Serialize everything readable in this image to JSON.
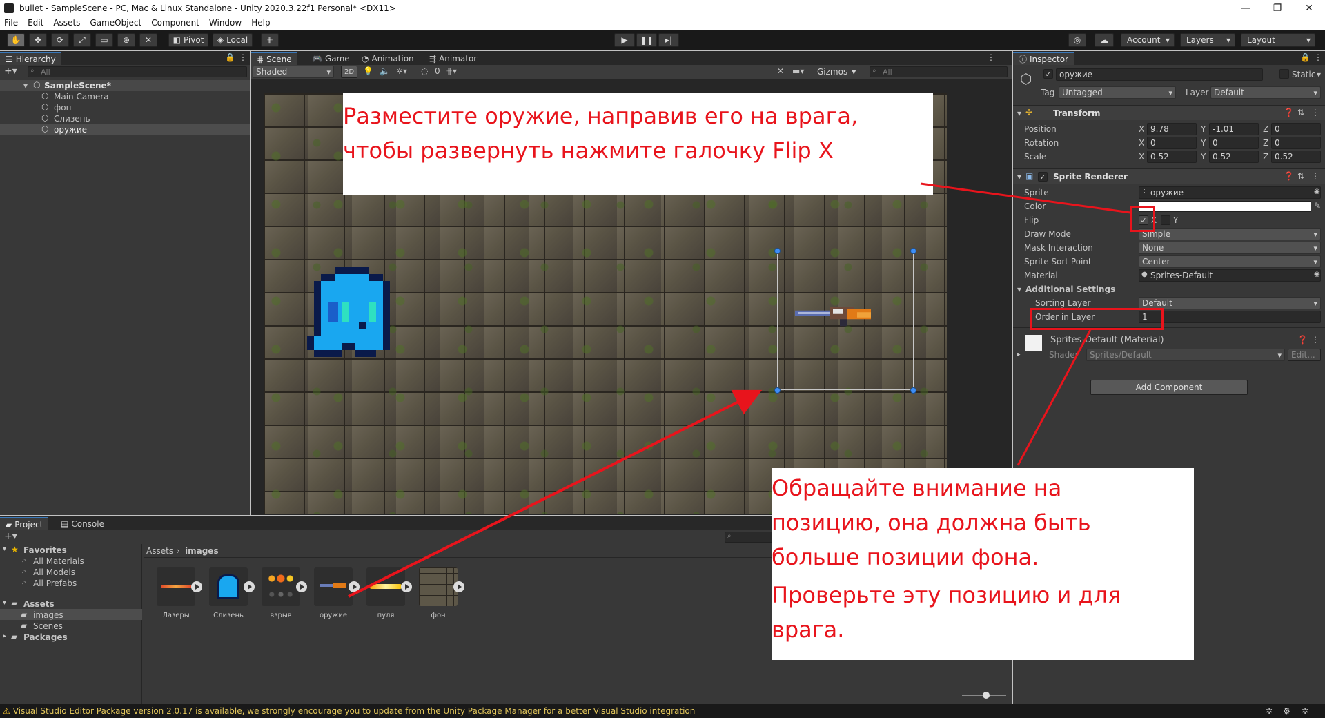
{
  "window": {
    "title": "bullet - SampleScene - PC, Mac & Linux Standalone - Unity 2020.3.22f1 Personal* <DX11>",
    "controls": [
      "—",
      "❐",
      "✕"
    ]
  },
  "menu": [
    "File",
    "Edit",
    "Assets",
    "GameObject",
    "Component",
    "Window",
    "Help"
  ],
  "toolbar": {
    "pivot": "Pivot",
    "local": "Local",
    "account": "Account",
    "layers": "Layers",
    "layout": "Layout"
  },
  "hierarchy": {
    "tab": "Hierarchy",
    "search_placeholder": "All",
    "scene": "SampleScene*",
    "items": [
      "Main Camera",
      "фон",
      "Слизень",
      "оружие"
    ]
  },
  "scene": {
    "tabs": [
      "Scene",
      "Game",
      "Animation",
      "Animator"
    ],
    "shading": "Shaded",
    "mode_2d": "2D",
    "hidden_count": "0",
    "gizmos": "Gizmos",
    "search_placeholder": "All"
  },
  "inspector": {
    "tab": "Inspector",
    "object_name": "оружие",
    "static": "Static",
    "tag_label": "Tag",
    "tag": "Untagged",
    "layer_label": "Layer",
    "layer": "Default",
    "transform": {
      "title": "Transform",
      "position_label": "Position",
      "rotation_label": "Rotation",
      "scale_label": "Scale",
      "axis_x": "X",
      "axis_y": "Y",
      "axis_z": "Z",
      "position": [
        "9.78",
        "-1.01",
        "0"
      ],
      "rotation": [
        "0",
        "0",
        "0"
      ],
      "scale": [
        "0.52",
        "0.52",
        "0.52"
      ]
    },
    "sprite_renderer": {
      "title": "Sprite Renderer",
      "sprite_label": "Sprite",
      "sprite": "оружие",
      "color_label": "Color",
      "flip_label": "Flip",
      "flip_x": "X",
      "flip_y": "Y",
      "draw_mode_label": "Draw Mode",
      "draw_mode": "Simple",
      "mask_label": "Mask Interaction",
      "mask": "None",
      "sort_point_label": "Sprite Sort Point",
      "sort_point": "Center",
      "material_label": "Material",
      "material": "Sprites-Default",
      "additional": "Additional Settings",
      "sorting_layer_label": "Sorting Layer",
      "sorting_layer": "Default",
      "order_label": "Order in Layer",
      "order": "1"
    },
    "material": {
      "title": "Sprites-Default (Material)",
      "shader_label": "Shader",
      "shader": "Sprites/Default",
      "edit": "Edit..."
    },
    "add_component": "Add Component"
  },
  "project": {
    "tabs": [
      "Project",
      "Console"
    ],
    "favorites": "Favorites",
    "favorite_items": [
      "All Materials",
      "All Models",
      "All Prefabs"
    ],
    "assets": "Assets",
    "asset_folders": [
      "images",
      "Scenes"
    ],
    "packages": "Packages",
    "breadcrumb_root": "Assets",
    "breadcrumb_current": "images",
    "files": [
      "Лазеры",
      "Слизень",
      "взрыв",
      "оружие",
      "пуля",
      "фон"
    ]
  },
  "annotations": {
    "top_line1": "Разместите оружие, направив его на врага,",
    "top_line2": "чтобы развернуть нажмите галочку Flip X",
    "bottom_line1": "Обращайте внимание на",
    "bottom_line2": "позицию, она должна быть",
    "bottom_line3": "больше позиции фона.",
    "bottom_line4": "Проверьте эту позицию и для",
    "bottom_line5": "врага."
  },
  "status": "Visual Studio Editor Package version 2.0.17 is available, we strongly encourage you to update from the Unity Package Manager for a better Visual Studio integration",
  "colors": {
    "accent": "#3a79bb",
    "annotation": "#e8141c",
    "selection": "#3d8ef7"
  }
}
